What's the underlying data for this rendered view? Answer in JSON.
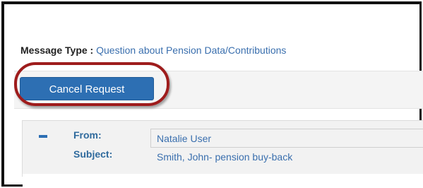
{
  "message_type": {
    "label": "Message Type :",
    "value": "Question about Pension Data/Contributions"
  },
  "toolbar": {
    "cancel_label": "Cancel Request"
  },
  "message": {
    "from_label": "From:",
    "from_value": "Natalie User",
    "subject_label": "Subject:",
    "subject_value": "Smith, John- pension buy-back"
  },
  "colors": {
    "button": "#2d6fb3",
    "link_text": "#3a6fae",
    "highlight_ring": "#9e1c1c"
  },
  "icons": {
    "collapse": "minus-icon"
  }
}
